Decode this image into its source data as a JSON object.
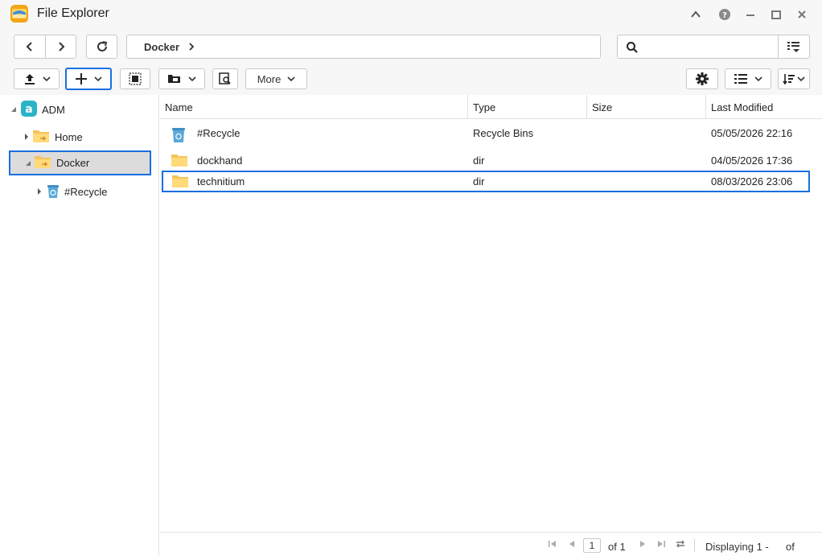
{
  "window": {
    "title": "File Explorer"
  },
  "address_bar": {
    "path": "Docker"
  },
  "search": {
    "value": "",
    "placeholder": ""
  },
  "toolbar": {
    "more_label": "More"
  },
  "tree": {
    "root": {
      "label": "ADM",
      "icon": "adm-logo-icon"
    },
    "items": [
      {
        "label": "Home",
        "icon": "shared-folder-icon"
      },
      {
        "label": "Docker",
        "icon": "shared-folder-icon",
        "selected": true
      },
      {
        "label": "#Recycle",
        "icon": "recycle-bin-icon"
      }
    ]
  },
  "table": {
    "columns": [
      "Name",
      "Type",
      "Size",
      "Last Modified"
    ],
    "rows": [
      {
        "name": "#Recycle",
        "type": "Recycle Bins",
        "size": "",
        "modified": "05/05/2026 22:16",
        "icon": "recycle-bin-icon"
      },
      {
        "name": "dockhand",
        "type": "dir",
        "size": "",
        "modified": "04/05/2026 17:36",
        "icon": "folder-icon"
      },
      {
        "name": "technitium",
        "type": "dir",
        "size": "",
        "modified": "08/03/2026 23:06",
        "icon": "folder-icon",
        "selected": true
      }
    ]
  },
  "pager": {
    "current_page": "1",
    "of_label": "of 1",
    "displaying": "Displaying 1 -",
    "of_total": "of"
  },
  "colors": {
    "accent": "#1a6fe0",
    "folder": "#f5c35a",
    "recycle": "#5aa9d6"
  }
}
